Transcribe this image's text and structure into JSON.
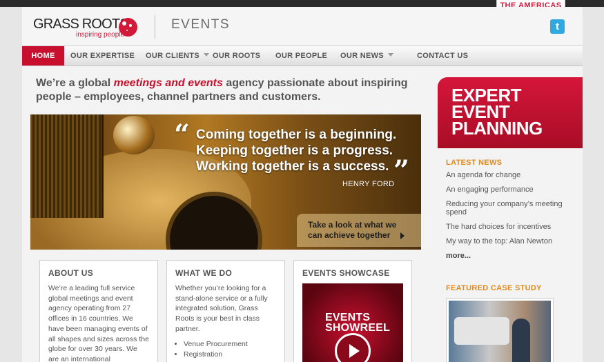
{
  "region": {
    "label": "THE AMERICAS"
  },
  "header": {
    "logo_name": "GRASS ROOTS",
    "logo_tagline": "inspiring people",
    "section_title": "EVENTS",
    "twitter_icon": "twitter-icon"
  },
  "nav": {
    "items": [
      {
        "label": "HOME",
        "active": true
      },
      {
        "label": "OUR EXPERTISE"
      },
      {
        "label": "OUR CLIENTS",
        "dropdown": true
      },
      {
        "label": "OUR ROOTS"
      },
      {
        "label": "OUR PEOPLE"
      },
      {
        "label": "OUR NEWS",
        "dropdown": true
      },
      {
        "label": "CONTACT US"
      }
    ]
  },
  "intro": {
    "before": "We’re a global ",
    "highlight": "meetings and events",
    "after": " agency passionate about inspiring people – employees, channel partners and customers."
  },
  "hero": {
    "quote_line1": "Coming together is a beginning.",
    "quote_line2": "Keeping together is a progress.",
    "quote_line3": "Working together is a success.",
    "author": "HENRY FORD",
    "cta_line1": "Take a look at what we",
    "cta_line2": "can achieve together"
  },
  "about": {
    "title": "ABOUT US",
    "text": "We’re a leading full service global meetings and event agency operating from 27 offices in 16 countries. We have been managing events of all shapes and sizes across the globe for over 30 years. We are an international"
  },
  "what_we_do": {
    "title": "WHAT WE DO",
    "text": "Whether you’re looking for a stand-alone service or a fully integrated solution, Grass Roots is your best in class partner.",
    "items": [
      "Venue Procurement",
      "Registration"
    ]
  },
  "showcase": {
    "title": "EVENTS SHOWCASE",
    "reel_line1": "EVENTS",
    "reel_line2": "SHOWREEL"
  },
  "promo": {
    "line1": "EXPERT",
    "line2": "EVENT",
    "line3": "PLANNING"
  },
  "latest_news": {
    "title": "LATEST NEWS",
    "items": [
      "An agenda for change",
      "An engaging performance",
      "Reducing your company’s meeting spend",
      "The hard choices for incentives",
      "My way to the top: Alan Newton"
    ],
    "more": "more..."
  },
  "featured": {
    "title": "FEATURED CASE STUDY"
  },
  "colors": {
    "brand_red": "#c8102e",
    "accent_orange": "#e08a1e",
    "twitter_blue": "#2fa9e0"
  }
}
